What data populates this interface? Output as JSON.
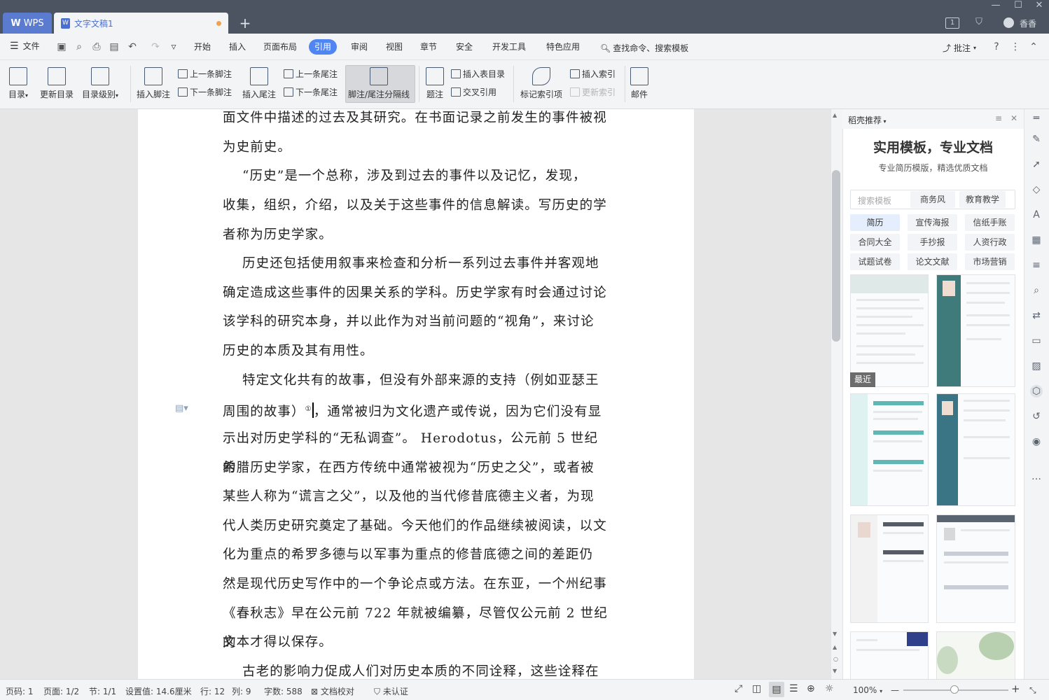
{
  "titlebar": {
    "app_tab": "WPS",
    "doc_tab": "文字文稿1",
    "user": "香香"
  },
  "menubar": {
    "file": "文件",
    "items": [
      "开始",
      "插入",
      "页面布局",
      "引用",
      "审阅",
      "视图",
      "章节",
      "安全",
      "开发工具",
      "特色应用"
    ],
    "active": "引用",
    "search": "查找命令、搜索模板",
    "annotate": "批注"
  },
  "ribbon": {
    "toc": "目录",
    "update_toc": "更新目录",
    "toc_level": "目录级别",
    "insert_footnote": "插入脚注",
    "prev_footnote": "上一条脚注",
    "next_footnote": "下一条脚注",
    "insert_endnote": "插入尾注",
    "prev_endnote": "上一条尾注",
    "next_endnote": "下一条尾注",
    "footnote_separator": "脚注/尾注分隔线",
    "caption": "题注",
    "insert_table_of_figures": "插入表目录",
    "cross_reference": "交叉引用",
    "mark_index": "标记索引项",
    "insert_index": "插入索引",
    "update_index": "更新索引",
    "mail": "邮件"
  },
  "document": {
    "p0a": "面文件中描述的过去及其研究。在书面记录之前发生的事件被视",
    "p0b": "为史前史。",
    "p1a": "“历史”是一个总称，涉及到过去的事件以及记忆，发现，",
    "p1b": "收集，组织，介绍，以及关于这些事件的信息解读。写历史的学",
    "p1c": "者称为历史学家。",
    "p2a": "历史还包括使用叙事来检查和分析一系列过去事件并客观地",
    "p2b": "确定造成这些事件的因果关系的学科。历史学家有时会通过讨论",
    "p2c": "该学科的研究本身，并以此作为对当前问题的“视角”，来讨论",
    "p2d": "历史的本质及其有用性。",
    "p3a": "特定文化共有的故事，但没有外部来源的支持（例如亚瑟王",
    "p3b_pre": "周围的故事）",
    "p3b_sup": "①",
    "p3b_post": "，通常被归为文化遗产或传说，因为它们没有显",
    "p3c": "示出对历史学科的“无私调查”。 Herodotus，公元前 5 世纪的",
    "p3d": "希腊历史学家，在西方传统中通常被视为“历史之父”，或者被",
    "p3e": "某些人称为“谎言之父”，以及他的当代修昔底德主义者，为现",
    "p3f": "代人类历史研究奠定了基础。今天他们的作品继续被阅读，以文",
    "p3g": "化为重点的希罗多德与以军事为重点的修昔底德之间的差距仍",
    "p3h": "然是现代历史写作中的一个争论点或方法。在东亚，一个州纪事",
    "p3i": "《春秋志》早在公元前 722 年就被编纂，尽管仅公元前 2 世纪的",
    "p3j": "文本才得以保存。",
    "p4a": "古老的影响力促成人们对历史本质的不同诠释，这些诠释在"
  },
  "panel": {
    "title": "稻壳推荐",
    "headline": "实用模板，专业文档",
    "subline": "专业简历模版，精选优质文档",
    "search_placeholder": "搜索模板",
    "search_tags": [
      "商务风",
      "教育教学"
    ],
    "categories": [
      "简历",
      "宣传海报",
      "信纸手账",
      "合同大全",
      "手抄报",
      "人资行政",
      "试题试卷",
      "论文文献",
      "市场营销"
    ],
    "recent_badge": "最近"
  },
  "statusbar": {
    "page_code": "页码: 1",
    "page": "页面: 1/2",
    "section": "节: 1/1",
    "setting": "设置值: 14.6厘米",
    "row": "行: 12",
    "col": "列: 9",
    "words": "字数: 588",
    "proofread": "文档校对",
    "cert": "未认证",
    "zoom": "100%"
  },
  "colors": {
    "accent": "#4f86f2",
    "titlebar": "#4c5461",
    "resume_teal": "#3e7b7a"
  }
}
